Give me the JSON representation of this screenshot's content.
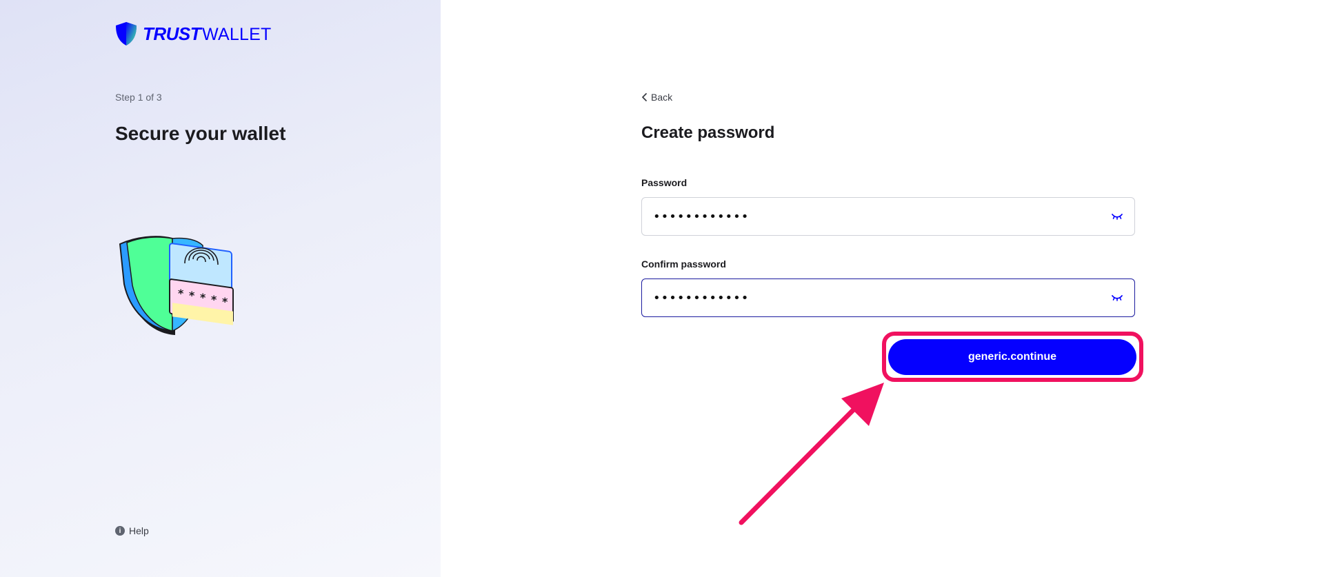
{
  "brand": {
    "name_bold": "TRUST",
    "name_light": "WALLET",
    "color": "#0500ff"
  },
  "left": {
    "step": "Step 1 of 3",
    "title": "Secure your wallet",
    "illustration_icon": "shield-fingerprint-password-illustration",
    "help_icon": "info-icon",
    "help_label": "Help"
  },
  "right": {
    "back_icon": "chevron-left-icon",
    "back_label": "Back",
    "title": "Create password",
    "password": {
      "label": "Password",
      "value": "••••••••••••",
      "toggle_icon": "eye-closed-icon"
    },
    "confirm_password": {
      "label": "Confirm password",
      "value": "••••••••••••",
      "toggle_icon": "eye-closed-icon"
    },
    "continue_label": "generic.continue"
  },
  "annotation": {
    "highlight_color": "#f0115f",
    "arrow_icon": "pointer-arrow-icon"
  }
}
